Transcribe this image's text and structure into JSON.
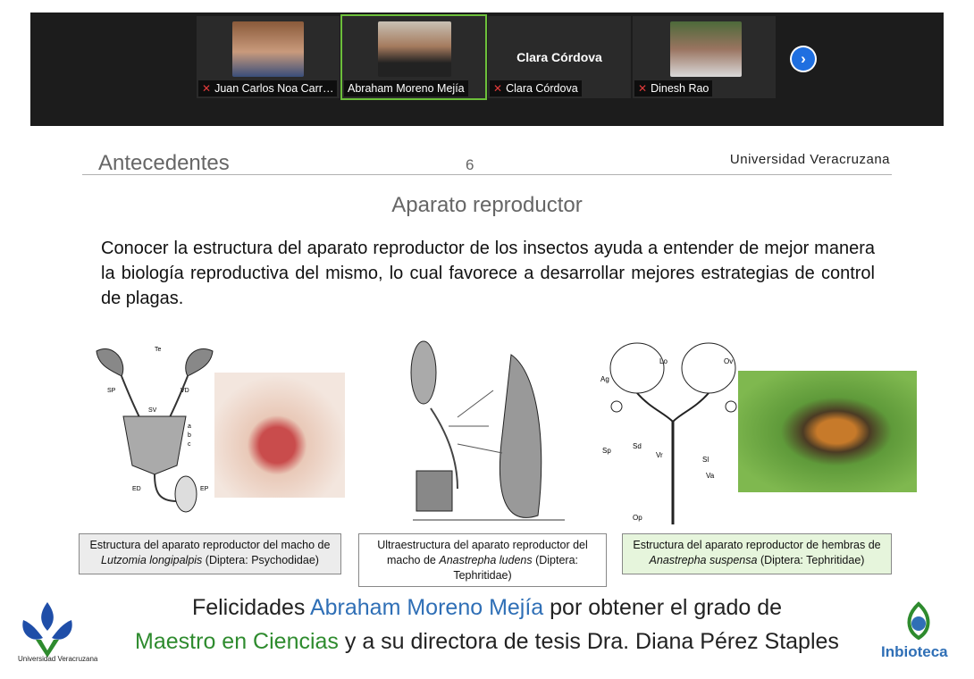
{
  "participants": [
    {
      "name": "Juan Carlos Noa Carr…",
      "muted": true
    },
    {
      "name": "Abraham Moreno Mejía",
      "muted": false
    },
    {
      "name": "Clara Córdova",
      "muted": true,
      "video_off_label": "Clara Córdova"
    },
    {
      "name": "Dinesh Rao",
      "muted": true
    }
  ],
  "next_page_icon": "chevron-right-icon",
  "slide": {
    "section": "Antecedentes",
    "page": "6",
    "institution": "Universidad Veracruzana",
    "subtitle": "Aparato reproductor",
    "body": "Conocer la estructura del aparato reproductor de los insectos ayuda a entender de mejor manera la biología reproductiva del mismo, lo cual favorece a desarrollar mejores estrategias de control de plagas.",
    "captions": [
      {
        "pre": "Estructura del aparato reproductor del macho de ",
        "species": "Lutzomia longipalpis",
        "post": " (Diptera: Psychodidae)"
      },
      {
        "pre": "Ultraestructura del aparato reproductor del macho de ",
        "species": "Anastrepha ludens",
        "post": " (Diptera: Tephritidae)"
      },
      {
        "pre": "Estructura del aparato reproductor de hembras de ",
        "species": "Anastrepha suspensa",
        "post": " (Diptera: Tephritidae)"
      }
    ],
    "diagram_labels": {
      "fig1": [
        "Te",
        "SP",
        "VD",
        "SV",
        "a",
        "b",
        "c",
        "ED",
        "EP"
      ],
      "fig3": [
        "Ag",
        "Lo",
        "Ov",
        "Sp",
        "Sd",
        "Vr",
        "Sl",
        "Va",
        "Op"
      ]
    }
  },
  "banner": {
    "line1_pre": "Felicidades ",
    "line1_name": "Abraham Moreno Mejía",
    "line1_post": " por obtener el grado de",
    "line2_degree": "Maestro en Ciencias",
    "line2_mid": " y a su directora de tesis ",
    "line2_name": "Dra. Diana Pérez Staples",
    "logo_left_text": "Universidad Veracruzana",
    "logo_right_text": "Inbioteca"
  },
  "colors": {
    "highlight_blue": "#2f6fb6",
    "highlight_green": "#2e8b2e",
    "active_speaker": "#6cbf3a"
  }
}
